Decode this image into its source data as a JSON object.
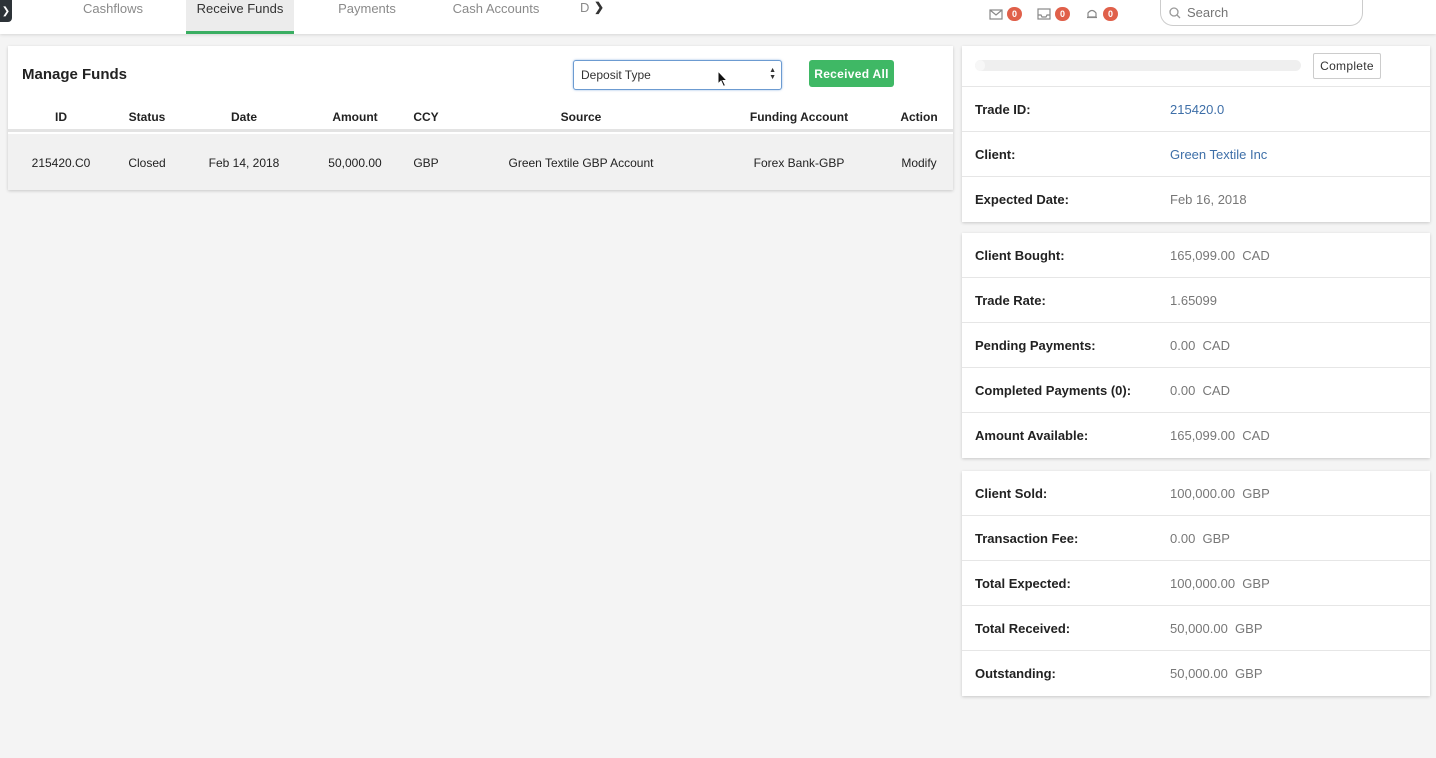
{
  "nav": {
    "tabs": [
      {
        "label": "Cashflows"
      },
      {
        "label": "Receive Funds"
      },
      {
        "label": "Payments"
      },
      {
        "label": "Cash Accounts"
      }
    ],
    "more_label": "D",
    "active_tab": "Receive Funds"
  },
  "notifications": [
    {
      "icon": "mail-icon",
      "count": "0"
    },
    {
      "icon": "inbox-icon",
      "count": "0"
    },
    {
      "icon": "bell-icon",
      "count": "0"
    }
  ],
  "search": {
    "placeholder": "Search"
  },
  "manage": {
    "title": "Manage Funds",
    "deposit_select": "Deposit Type",
    "received_all_label": "Received All",
    "columns": [
      "ID",
      "Status",
      "Date",
      "Amount",
      "CCY",
      "Source",
      "Funding Account",
      "Action"
    ],
    "rows": [
      {
        "id": "215420.C0",
        "status": "Closed",
        "date": "Feb 14, 2018",
        "amount": "50,000.00",
        "ccy": "GBP",
        "source": "Green Textile GBP Account",
        "funding_account": "Forex Bank-GBP",
        "action": "Modify"
      }
    ]
  },
  "trade": {
    "progress_fraction": 0.03,
    "complete_label": "Complete",
    "trade_id_label": "Trade ID:",
    "trade_id": "215420.0",
    "client_label": "Client:",
    "client": "Green Textile Inc",
    "expected_date_label": "Expected Date:",
    "expected_date": "Feb 16, 2018"
  },
  "buy_card": [
    {
      "label": "Client Bought:",
      "value": "165,099.00  CAD"
    },
    {
      "label": "Trade Rate:",
      "value": "1.65099"
    },
    {
      "label": "Pending Payments:",
      "value": "0.00  CAD"
    },
    {
      "label": "Completed Payments (0):",
      "value": "0.00  CAD"
    },
    {
      "label": "Amount Available:",
      "value": "165,099.00  CAD"
    }
  ],
  "sell_card": [
    {
      "label": "Client Sold:",
      "value": "100,000.00  GBP"
    },
    {
      "label": "Transaction Fee:",
      "value": "0.00  GBP"
    },
    {
      "label": "Total Expected:",
      "value": "100,000.00  GBP"
    },
    {
      "label": "Total Received:",
      "value": "50,000.00  GBP"
    },
    {
      "label": "Outstanding:",
      "value": "50,000.00  GBP"
    }
  ],
  "colors": {
    "accent": "#3fb865",
    "badge": "#e0604a",
    "link": "#3e6fa8"
  }
}
